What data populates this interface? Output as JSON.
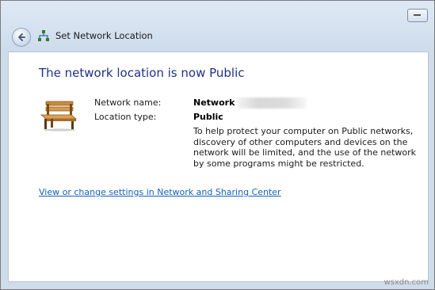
{
  "window": {
    "title": "Set Network Location"
  },
  "icons": {
    "back": "back-arrow-icon",
    "network": "network-icon",
    "location": "park-bench-icon",
    "window_control": "minimize-icon"
  },
  "main": {
    "heading": "The network location is now Public",
    "network_name_label": "Network name:",
    "network_name_value": "Network",
    "location_type_label": "Location type:",
    "location_type_value": "Public",
    "description": "To help protect your computer on Public networks, discovery of other computers and devices on the network will be limited, and the use of the network by some programs might be restricted.",
    "link": "View or change settings in Network and Sharing Center"
  },
  "watermark": "wsxdn.com",
  "colors": {
    "heading": "#1e3287",
    "link": "#1560b8",
    "chrome": "#d5e2f0"
  }
}
